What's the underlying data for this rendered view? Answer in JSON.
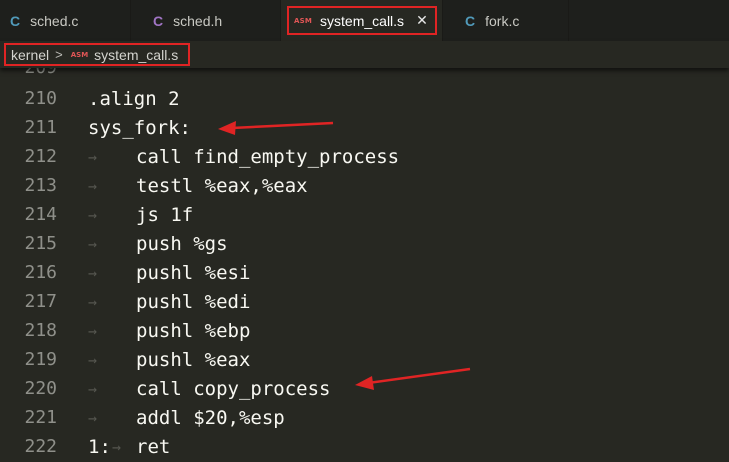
{
  "tabs": [
    {
      "icon": "C",
      "label": "sched.c"
    },
    {
      "icon": "C",
      "label": "sched.h"
    },
    {
      "icon": "ASM",
      "label": "system_call.s",
      "close": "✕"
    },
    {
      "icon": "C",
      "label": "fork.c"
    }
  ],
  "breadcrumb": {
    "folder": "kernel",
    "separator": ">",
    "file_icon": "ASM",
    "file": "system_call.s"
  },
  "code": {
    "partial_line_number": "209",
    "tab_glyph": "→",
    "lines": [
      {
        "num": "210",
        "indent": false,
        "prefix": "",
        "text": ".align 2"
      },
      {
        "num": "211",
        "indent": false,
        "prefix": "",
        "text": "sys_fork:"
      },
      {
        "num": "212",
        "indent": true,
        "prefix": "",
        "text": "call find_empty_process"
      },
      {
        "num": "213",
        "indent": true,
        "prefix": "",
        "text": "testl %eax,%eax"
      },
      {
        "num": "214",
        "indent": true,
        "prefix": "",
        "text": "js 1f"
      },
      {
        "num": "215",
        "indent": true,
        "prefix": "",
        "text": "push %gs"
      },
      {
        "num": "216",
        "indent": true,
        "prefix": "",
        "text": "pushl %esi"
      },
      {
        "num": "217",
        "indent": true,
        "prefix": "",
        "text": "pushl %edi"
      },
      {
        "num": "218",
        "indent": true,
        "prefix": "",
        "text": "pushl %ebp"
      },
      {
        "num": "219",
        "indent": true,
        "prefix": "",
        "text": "pushl %eax"
      },
      {
        "num": "220",
        "indent": true,
        "prefix": "",
        "text": "call copy_process"
      },
      {
        "num": "221",
        "indent": true,
        "prefix": "",
        "text": "addl $20,%esp"
      },
      {
        "num": "222",
        "indent": false,
        "prefix": "1:",
        "text": "ret"
      }
    ]
  },
  "colors": {
    "annotation_red": "#e02424",
    "c_icon": "#519aba",
    "asm_icon": "#e15656",
    "editor_bg": "#272822"
  }
}
